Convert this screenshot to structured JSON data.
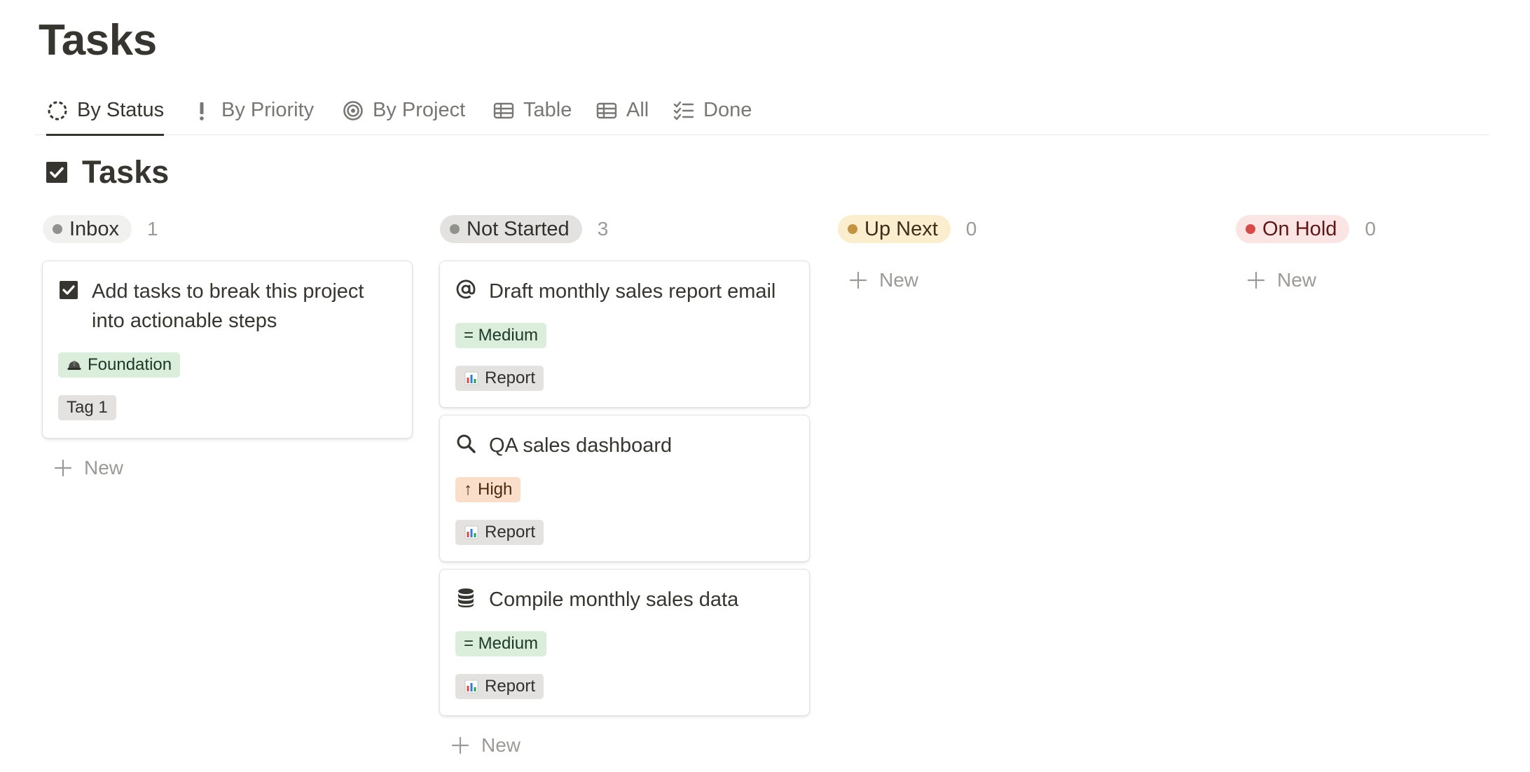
{
  "page": {
    "title": "Tasks"
  },
  "tabs": [
    {
      "label": "By Status",
      "icon": "status-circle-icon",
      "active": true
    },
    {
      "label": "By Priority",
      "icon": "exclamation-icon",
      "active": false
    },
    {
      "label": "By Project",
      "icon": "target-icon",
      "active": false
    },
    {
      "label": "Table",
      "icon": "table-icon",
      "active": false
    },
    {
      "label": "All",
      "icon": "table-icon",
      "active": false
    },
    {
      "label": "Done",
      "icon": "checklist-icon",
      "active": false
    }
  ],
  "database": {
    "title": "Tasks",
    "icon": "checkbox-icon"
  },
  "columns": [
    {
      "status": "Inbox",
      "count": "1",
      "pill_color": "#f1f1ef",
      "dot_color": "#91918e",
      "text_color": "#32302c",
      "new_label": "New",
      "cards": [
        {
          "title": "Add tasks to break this project into actionable steps",
          "icon": "checkbox-icon",
          "tags": [
            {
              "label": "Foundation",
              "icon": "construction-helmet-icon",
              "color": "green"
            },
            {
              "label": "Tag 1",
              "color": "gray"
            }
          ]
        }
      ]
    },
    {
      "status": "Not Started",
      "count": "3",
      "pill_color": "#e3e2e0",
      "dot_color": "#91918e",
      "text_color": "#32302c",
      "new_label": "New",
      "cards": [
        {
          "title": "Draft monthly sales report email",
          "icon": "at-sign-icon",
          "tags": [
            {
              "label": "= Medium",
              "color": "green"
            },
            {
              "label": "Report",
              "icon": "bar-chart-icon",
              "color": "gray"
            }
          ]
        },
        {
          "title": "QA sales dashboard",
          "icon": "search-icon",
          "tags": [
            {
              "label": "High",
              "arrow": "↑",
              "color": "orange"
            },
            {
              "label": "Report",
              "icon": "bar-chart-icon",
              "color": "gray"
            }
          ]
        },
        {
          "title": "Compile monthly sales data",
          "icon": "database-icon",
          "tags": [
            {
              "label": "= Medium",
              "color": "green"
            },
            {
              "label": "Report",
              "icon": "bar-chart-icon",
              "color": "gray"
            }
          ]
        }
      ]
    },
    {
      "status": "Up Next",
      "count": "0",
      "pill_color": "#fbeecf",
      "dot_color": "#c29343",
      "text_color": "#402c1b",
      "new_label": "New",
      "cards": []
    },
    {
      "status": "On Hold",
      "count": "0",
      "pill_color": "#fbe4e4",
      "dot_color": "#d44c47",
      "text_color": "#5d1715",
      "new_label": "New",
      "cards": []
    }
  ]
}
